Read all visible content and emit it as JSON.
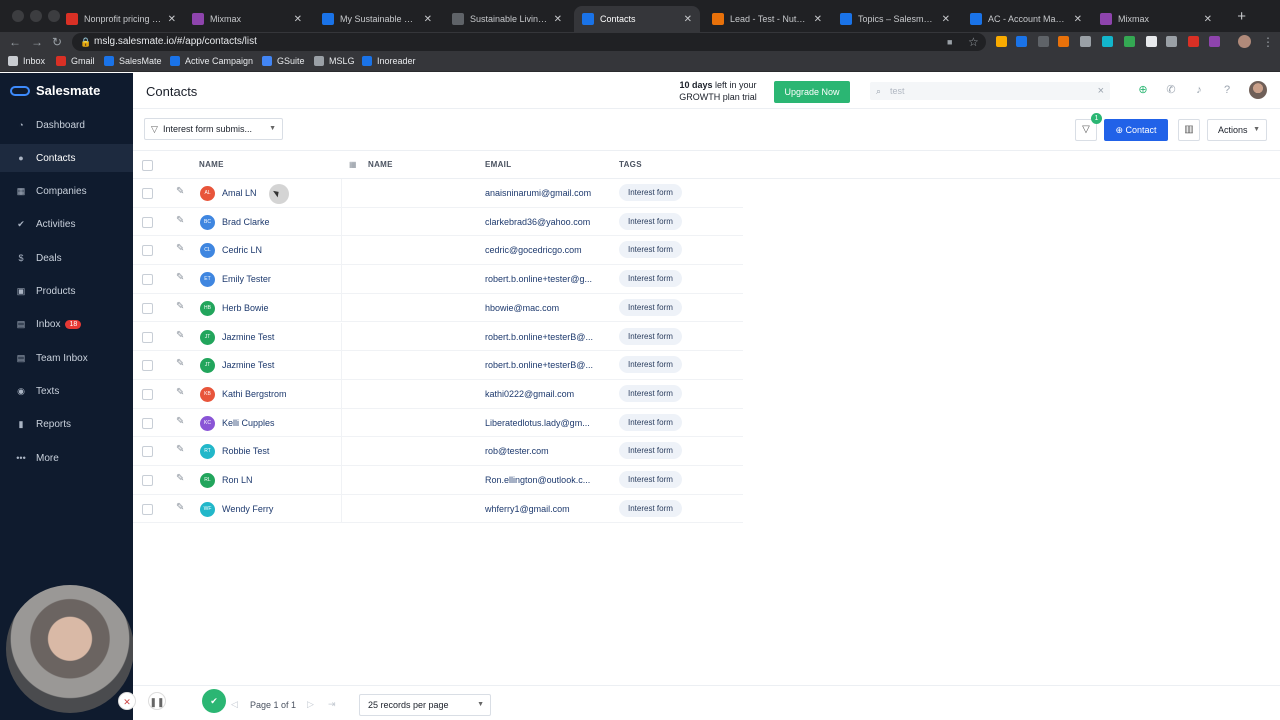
{
  "browser": {
    "tabs": [
      {
        "title": "Nonprofit pricing - rob",
        "icon": "gmail-icon",
        "color": "#d93025"
      },
      {
        "title": "Mixmax",
        "icon": "mixmax-icon",
        "color": "#8e44ad"
      },
      {
        "title": "My Sustainable Living",
        "icon": "calendar-icon",
        "color": "#1a73e8"
      },
      {
        "title": "Sustainable Living Gui",
        "icon": "globe-icon",
        "color": "#5f6368"
      },
      {
        "title": "Contacts",
        "icon": "salesmate-icon",
        "color": "#1a73e8"
      },
      {
        "title": "Lead - Test - Nutshell",
        "icon": "nutshell-icon",
        "color": "#e8710a"
      },
      {
        "title": "Topics – Salesmate",
        "icon": "salesmate-icon",
        "color": "#1a73e8"
      },
      {
        "title": "AC - Account Manager",
        "icon": "activecampaign-icon",
        "color": "#1a73e8"
      },
      {
        "title": "Mixmax",
        "icon": "mixmax-icon",
        "color": "#8e44ad"
      }
    ],
    "url": "mslg.salesmate.io/#/app/contacts/list",
    "bookmarks": [
      {
        "label": "Inbox",
        "icon": "folder-icon",
        "color": "#c9ccd1"
      },
      {
        "label": "Gmail",
        "icon": "gmail-icon",
        "color": "#d93025"
      },
      {
        "label": "SalesMate",
        "icon": "salesmate-icon",
        "color": "#1a73e8"
      },
      {
        "label": "Active Campaign",
        "icon": "activecampaign-icon",
        "color": "#1a73e8"
      },
      {
        "label": "GSuite",
        "icon": "gsuite-icon",
        "color": "#4285f4"
      },
      {
        "label": "MSLG",
        "icon": "globe-icon",
        "color": "#9aa0a6"
      },
      {
        "label": "Inoreader",
        "icon": "inoreader-icon",
        "color": "#1a73e8"
      }
    ]
  },
  "app": {
    "brand": "Salesmate",
    "nav": [
      {
        "label": "Dashboard",
        "icon": "dashboard-icon",
        "glyph": "◔"
      },
      {
        "label": "Contacts",
        "icon": "person-icon",
        "glyph": "●"
      },
      {
        "label": "Companies",
        "icon": "building-icon",
        "glyph": "▦"
      },
      {
        "label": "Activities",
        "icon": "check-circle-icon",
        "glyph": "✔"
      },
      {
        "label": "Deals",
        "icon": "dollar-icon",
        "glyph": "$"
      },
      {
        "label": "Products",
        "icon": "box-icon",
        "glyph": "▣"
      },
      {
        "label": "Inbox",
        "icon": "inbox-icon",
        "glyph": "▤",
        "badge": "18"
      },
      {
        "label": "Team Inbox",
        "icon": "team-inbox-icon",
        "glyph": "▤"
      },
      {
        "label": "Texts",
        "icon": "chat-icon",
        "glyph": "◉"
      },
      {
        "label": "Reports",
        "icon": "bar-chart-icon",
        "glyph": "▮"
      },
      {
        "label": "More",
        "icon": "more-icon",
        "glyph": "•••"
      }
    ]
  },
  "header": {
    "title": "Contacts",
    "trial_days": "10 days",
    "trial_rest": " left in your",
    "trial_line2": "GROWTH plan trial",
    "upgrade_label": "Upgrade Now",
    "search_value": "test"
  },
  "toolbar": {
    "view_label": "Interest form submis...",
    "filter_count": "1",
    "add_label": "Contact",
    "actions_label": "Actions"
  },
  "table": {
    "headers": {
      "name": "NAME",
      "company_name": "NAME",
      "email": "EMAIL",
      "tags": "TAGS"
    },
    "rows": [
      {
        "initials": "AL",
        "name": "Amal LN",
        "email": "anaisninarumi@gmail.com",
        "tag": "Interest form",
        "color": "#e8553b"
      },
      {
        "initials": "BC",
        "name": "Brad Clarke",
        "email": "clarkebrad36@yahoo.com",
        "tag": "Interest form",
        "color": "#3f86e0"
      },
      {
        "initials": "CL",
        "name": "Cedric LN",
        "email": "cedric@gocedricgo.com",
        "tag": "Interest form",
        "color": "#3f86e0"
      },
      {
        "initials": "ET",
        "name": "Emily Tester",
        "email": "robert.b.online+tester@g...",
        "tag": "Interest form",
        "color": "#3f86e0"
      },
      {
        "initials": "HB",
        "name": "Herb Bowie",
        "email": "hbowie@mac.com",
        "tag": "Interest form",
        "color": "#22a55c"
      },
      {
        "initials": "JT",
        "name": "Jazmine Test",
        "email": "robert.b.online+testerB@...",
        "tag": "Interest form",
        "color": "#22a55c"
      },
      {
        "initials": "JT",
        "name": "Jazmine Test",
        "email": "robert.b.online+testerB@...",
        "tag": "Interest form",
        "color": "#22a55c"
      },
      {
        "initials": "KB",
        "name": "Kathi Bergstrom",
        "email": "kathi0222@gmail.com",
        "tag": "Interest form",
        "color": "#e8553b"
      },
      {
        "initials": "KC",
        "name": "Kelli Cupples",
        "email": "Liberatedlotus.lady@gm...",
        "tag": "Interest form",
        "color": "#8a55d6"
      },
      {
        "initials": "RT",
        "name": "Robbie Test",
        "email": "rob@tester.com",
        "tag": "Interest form",
        "color": "#22b7c9"
      },
      {
        "initials": "RL",
        "name": "Ron LN",
        "email": "Ron.ellington@outlook.c...",
        "tag": "Interest form",
        "color": "#22a55c"
      },
      {
        "initials": "WF",
        "name": "Wendy Ferry",
        "email": "whferry1@gmail.com",
        "tag": "Interest form",
        "color": "#22b7c9"
      }
    ]
  },
  "footer": {
    "page_info": "Page 1 of 1",
    "per_page": "25 records per page"
  }
}
